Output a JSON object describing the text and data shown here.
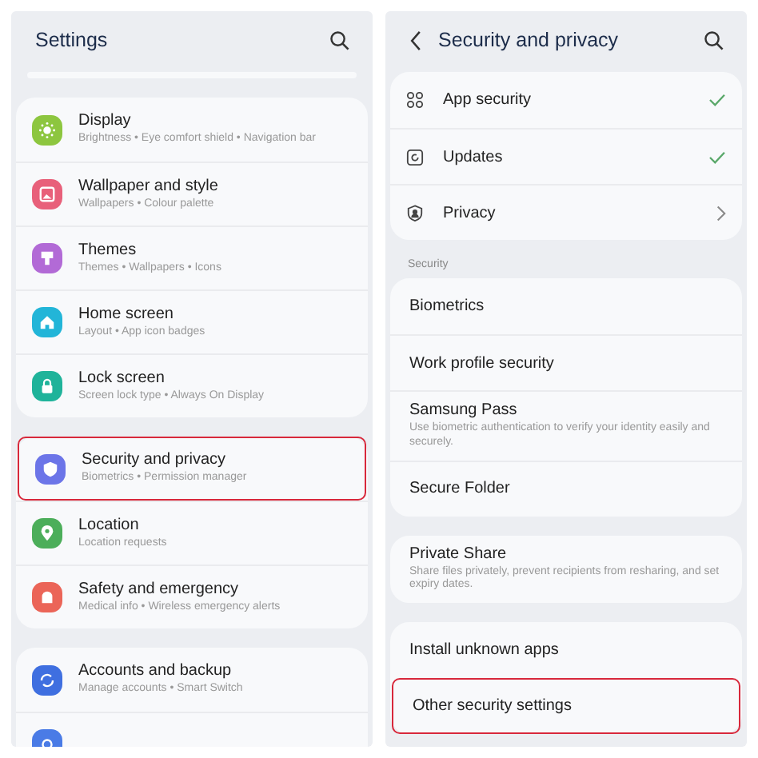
{
  "screens": [
    {
      "title": "Settings",
      "back": false,
      "stub": true,
      "groups": [
        {
          "items": [
            {
              "title": "Display",
              "subtitle": "Brightness • Eye comfort shield • Navigation bar",
              "color": "#8dc63f",
              "highlighted": false
            },
            {
              "title": "Wallpaper and style",
              "subtitle": "Wallpapers • Colour palette",
              "color": "#e8607a",
              "highlighted": false
            },
            {
              "title": "Themes",
              "subtitle": "Themes • Wallpapers • Icons",
              "color": "#b26ad6",
              "highlighted": false
            },
            {
              "title": "Home screen",
              "subtitle": "Layout • App icon badges",
              "color": "#22b5d8",
              "highlighted": false
            },
            {
              "title": "Lock screen",
              "subtitle": "Screen lock type • Always On Display",
              "color": "#1fb39a",
              "highlighted": false
            }
          ]
        },
        {
          "items": [
            {
              "title": "Security and privacy",
              "subtitle": "Biometrics • Permission manager",
              "color": "#6c75e8",
              "highlighted": true
            },
            {
              "title": "Location",
              "subtitle": "Location requests",
              "color": "#4cae5a",
              "highlighted": false
            },
            {
              "title": "Safety and emergency",
              "subtitle": "Medical info • Wireless emergency alerts",
              "color": "#eb6558",
              "highlighted": false
            }
          ]
        },
        {
          "items": [
            {
              "title": "Accounts and backup",
              "subtitle": "Manage accounts • Smart Switch",
              "color": "#3f6fe0",
              "highlighted": false
            },
            {
              "color": "#4a7be6",
              "highlighted": false
            }
          ]
        }
      ]
    },
    {
      "title": "Security and privacy",
      "back": true,
      "stub": false,
      "groups": [
        {
          "items": [
            {
              "kind": "status",
              "title": "App security",
              "highlighted": false
            },
            {
              "kind": "status",
              "title": "Updates",
              "highlighted": false
            },
            {
              "kind": "link",
              "title": "Privacy",
              "highlighted": false
            }
          ]
        },
        {
          "label": "Security",
          "items": [
            {
              "title": "Biometrics",
              "highlighted": false
            },
            {
              "title": "Work profile security",
              "highlighted": false
            },
            {
              "title": "Samsung Pass",
              "subtitle": "Use biometric authentication to verify your identity easily and securely.",
              "highlighted": false
            },
            {
              "title": "Secure Folder",
              "highlighted": false
            }
          ]
        },
        {
          "items": [
            {
              "title": "Private Share",
              "subtitle": "Share files privately, prevent recipients from resharing, and set expiry dates.",
              "highlighted": false
            }
          ]
        },
        {
          "items": [
            {
              "title": "Install unknown apps",
              "highlighted": false
            },
            {
              "title": "Other security settings",
              "highlighted": true
            }
          ]
        }
      ]
    }
  ]
}
